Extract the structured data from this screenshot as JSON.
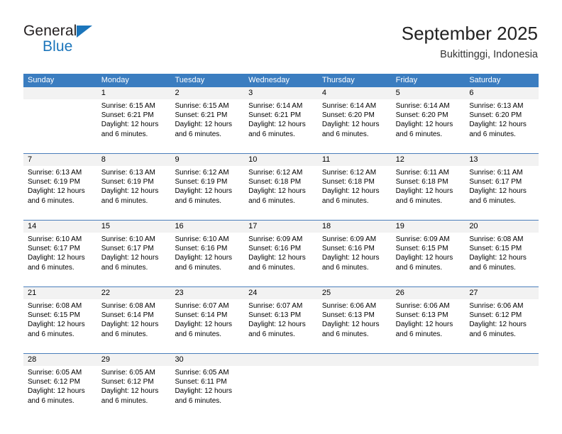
{
  "brand": {
    "name_top": "General",
    "name_bottom": "Blue",
    "triangle_color": "#1b75bb"
  },
  "header": {
    "title": "September 2025",
    "subtitle": "Bukittinggi, Indonesia"
  },
  "theme": {
    "header_bg": "#3b7dc0",
    "header_text": "#ffffff",
    "daynum_bg": "#f2f2f2",
    "row_divider": "#4a7ebb"
  },
  "weekday_headers": [
    "Sunday",
    "Monday",
    "Tuesday",
    "Wednesday",
    "Thursday",
    "Friday",
    "Saturday"
  ],
  "weeks": [
    {
      "days": [
        {
          "num": "",
          "lines": [
            "",
            "",
            "",
            ""
          ]
        },
        {
          "num": "1",
          "lines": [
            "Sunrise: 6:15 AM",
            "Sunset: 6:21 PM",
            "Daylight: 12 hours",
            "and 6 minutes."
          ]
        },
        {
          "num": "2",
          "lines": [
            "Sunrise: 6:15 AM",
            "Sunset: 6:21 PM",
            "Daylight: 12 hours",
            "and 6 minutes."
          ]
        },
        {
          "num": "3",
          "lines": [
            "Sunrise: 6:14 AM",
            "Sunset: 6:21 PM",
            "Daylight: 12 hours",
            "and 6 minutes."
          ]
        },
        {
          "num": "4",
          "lines": [
            "Sunrise: 6:14 AM",
            "Sunset: 6:20 PM",
            "Daylight: 12 hours",
            "and 6 minutes."
          ]
        },
        {
          "num": "5",
          "lines": [
            "Sunrise: 6:14 AM",
            "Sunset: 6:20 PM",
            "Daylight: 12 hours",
            "and 6 minutes."
          ]
        },
        {
          "num": "6",
          "lines": [
            "Sunrise: 6:13 AM",
            "Sunset: 6:20 PM",
            "Daylight: 12 hours",
            "and 6 minutes."
          ]
        }
      ]
    },
    {
      "days": [
        {
          "num": "7",
          "lines": [
            "Sunrise: 6:13 AM",
            "Sunset: 6:19 PM",
            "Daylight: 12 hours",
            "and 6 minutes."
          ]
        },
        {
          "num": "8",
          "lines": [
            "Sunrise: 6:13 AM",
            "Sunset: 6:19 PM",
            "Daylight: 12 hours",
            "and 6 minutes."
          ]
        },
        {
          "num": "9",
          "lines": [
            "Sunrise: 6:12 AM",
            "Sunset: 6:19 PM",
            "Daylight: 12 hours",
            "and 6 minutes."
          ]
        },
        {
          "num": "10",
          "lines": [
            "Sunrise: 6:12 AM",
            "Sunset: 6:18 PM",
            "Daylight: 12 hours",
            "and 6 minutes."
          ]
        },
        {
          "num": "11",
          "lines": [
            "Sunrise: 6:12 AM",
            "Sunset: 6:18 PM",
            "Daylight: 12 hours",
            "and 6 minutes."
          ]
        },
        {
          "num": "12",
          "lines": [
            "Sunrise: 6:11 AM",
            "Sunset: 6:18 PM",
            "Daylight: 12 hours",
            "and 6 minutes."
          ]
        },
        {
          "num": "13",
          "lines": [
            "Sunrise: 6:11 AM",
            "Sunset: 6:17 PM",
            "Daylight: 12 hours",
            "and 6 minutes."
          ]
        }
      ]
    },
    {
      "days": [
        {
          "num": "14",
          "lines": [
            "Sunrise: 6:10 AM",
            "Sunset: 6:17 PM",
            "Daylight: 12 hours",
            "and 6 minutes."
          ]
        },
        {
          "num": "15",
          "lines": [
            "Sunrise: 6:10 AM",
            "Sunset: 6:17 PM",
            "Daylight: 12 hours",
            "and 6 minutes."
          ]
        },
        {
          "num": "16",
          "lines": [
            "Sunrise: 6:10 AM",
            "Sunset: 6:16 PM",
            "Daylight: 12 hours",
            "and 6 minutes."
          ]
        },
        {
          "num": "17",
          "lines": [
            "Sunrise: 6:09 AM",
            "Sunset: 6:16 PM",
            "Daylight: 12 hours",
            "and 6 minutes."
          ]
        },
        {
          "num": "18",
          "lines": [
            "Sunrise: 6:09 AM",
            "Sunset: 6:16 PM",
            "Daylight: 12 hours",
            "and 6 minutes."
          ]
        },
        {
          "num": "19",
          "lines": [
            "Sunrise: 6:09 AM",
            "Sunset: 6:15 PM",
            "Daylight: 12 hours",
            "and 6 minutes."
          ]
        },
        {
          "num": "20",
          "lines": [
            "Sunrise: 6:08 AM",
            "Sunset: 6:15 PM",
            "Daylight: 12 hours",
            "and 6 minutes."
          ]
        }
      ]
    },
    {
      "days": [
        {
          "num": "21",
          "lines": [
            "Sunrise: 6:08 AM",
            "Sunset: 6:15 PM",
            "Daylight: 12 hours",
            "and 6 minutes."
          ]
        },
        {
          "num": "22",
          "lines": [
            "Sunrise: 6:08 AM",
            "Sunset: 6:14 PM",
            "Daylight: 12 hours",
            "and 6 minutes."
          ]
        },
        {
          "num": "23",
          "lines": [
            "Sunrise: 6:07 AM",
            "Sunset: 6:14 PM",
            "Daylight: 12 hours",
            "and 6 minutes."
          ]
        },
        {
          "num": "24",
          "lines": [
            "Sunrise: 6:07 AM",
            "Sunset: 6:13 PM",
            "Daylight: 12 hours",
            "and 6 minutes."
          ]
        },
        {
          "num": "25",
          "lines": [
            "Sunrise: 6:06 AM",
            "Sunset: 6:13 PM",
            "Daylight: 12 hours",
            "and 6 minutes."
          ]
        },
        {
          "num": "26",
          "lines": [
            "Sunrise: 6:06 AM",
            "Sunset: 6:13 PM",
            "Daylight: 12 hours",
            "and 6 minutes."
          ]
        },
        {
          "num": "27",
          "lines": [
            "Sunrise: 6:06 AM",
            "Sunset: 6:12 PM",
            "Daylight: 12 hours",
            "and 6 minutes."
          ]
        }
      ]
    },
    {
      "days": [
        {
          "num": "28",
          "lines": [
            "Sunrise: 6:05 AM",
            "Sunset: 6:12 PM",
            "Daylight: 12 hours",
            "and 6 minutes."
          ]
        },
        {
          "num": "29",
          "lines": [
            "Sunrise: 6:05 AM",
            "Sunset: 6:12 PM",
            "Daylight: 12 hours",
            "and 6 minutes."
          ]
        },
        {
          "num": "30",
          "lines": [
            "Sunrise: 6:05 AM",
            "Sunset: 6:11 PM",
            "Daylight: 12 hours",
            "and 6 minutes."
          ]
        },
        {
          "num": "",
          "lines": [
            "",
            "",
            "",
            ""
          ]
        },
        {
          "num": "",
          "lines": [
            "",
            "",
            "",
            ""
          ]
        },
        {
          "num": "",
          "lines": [
            "",
            "",
            "",
            ""
          ]
        },
        {
          "num": "",
          "lines": [
            "",
            "",
            "",
            ""
          ]
        }
      ]
    }
  ]
}
